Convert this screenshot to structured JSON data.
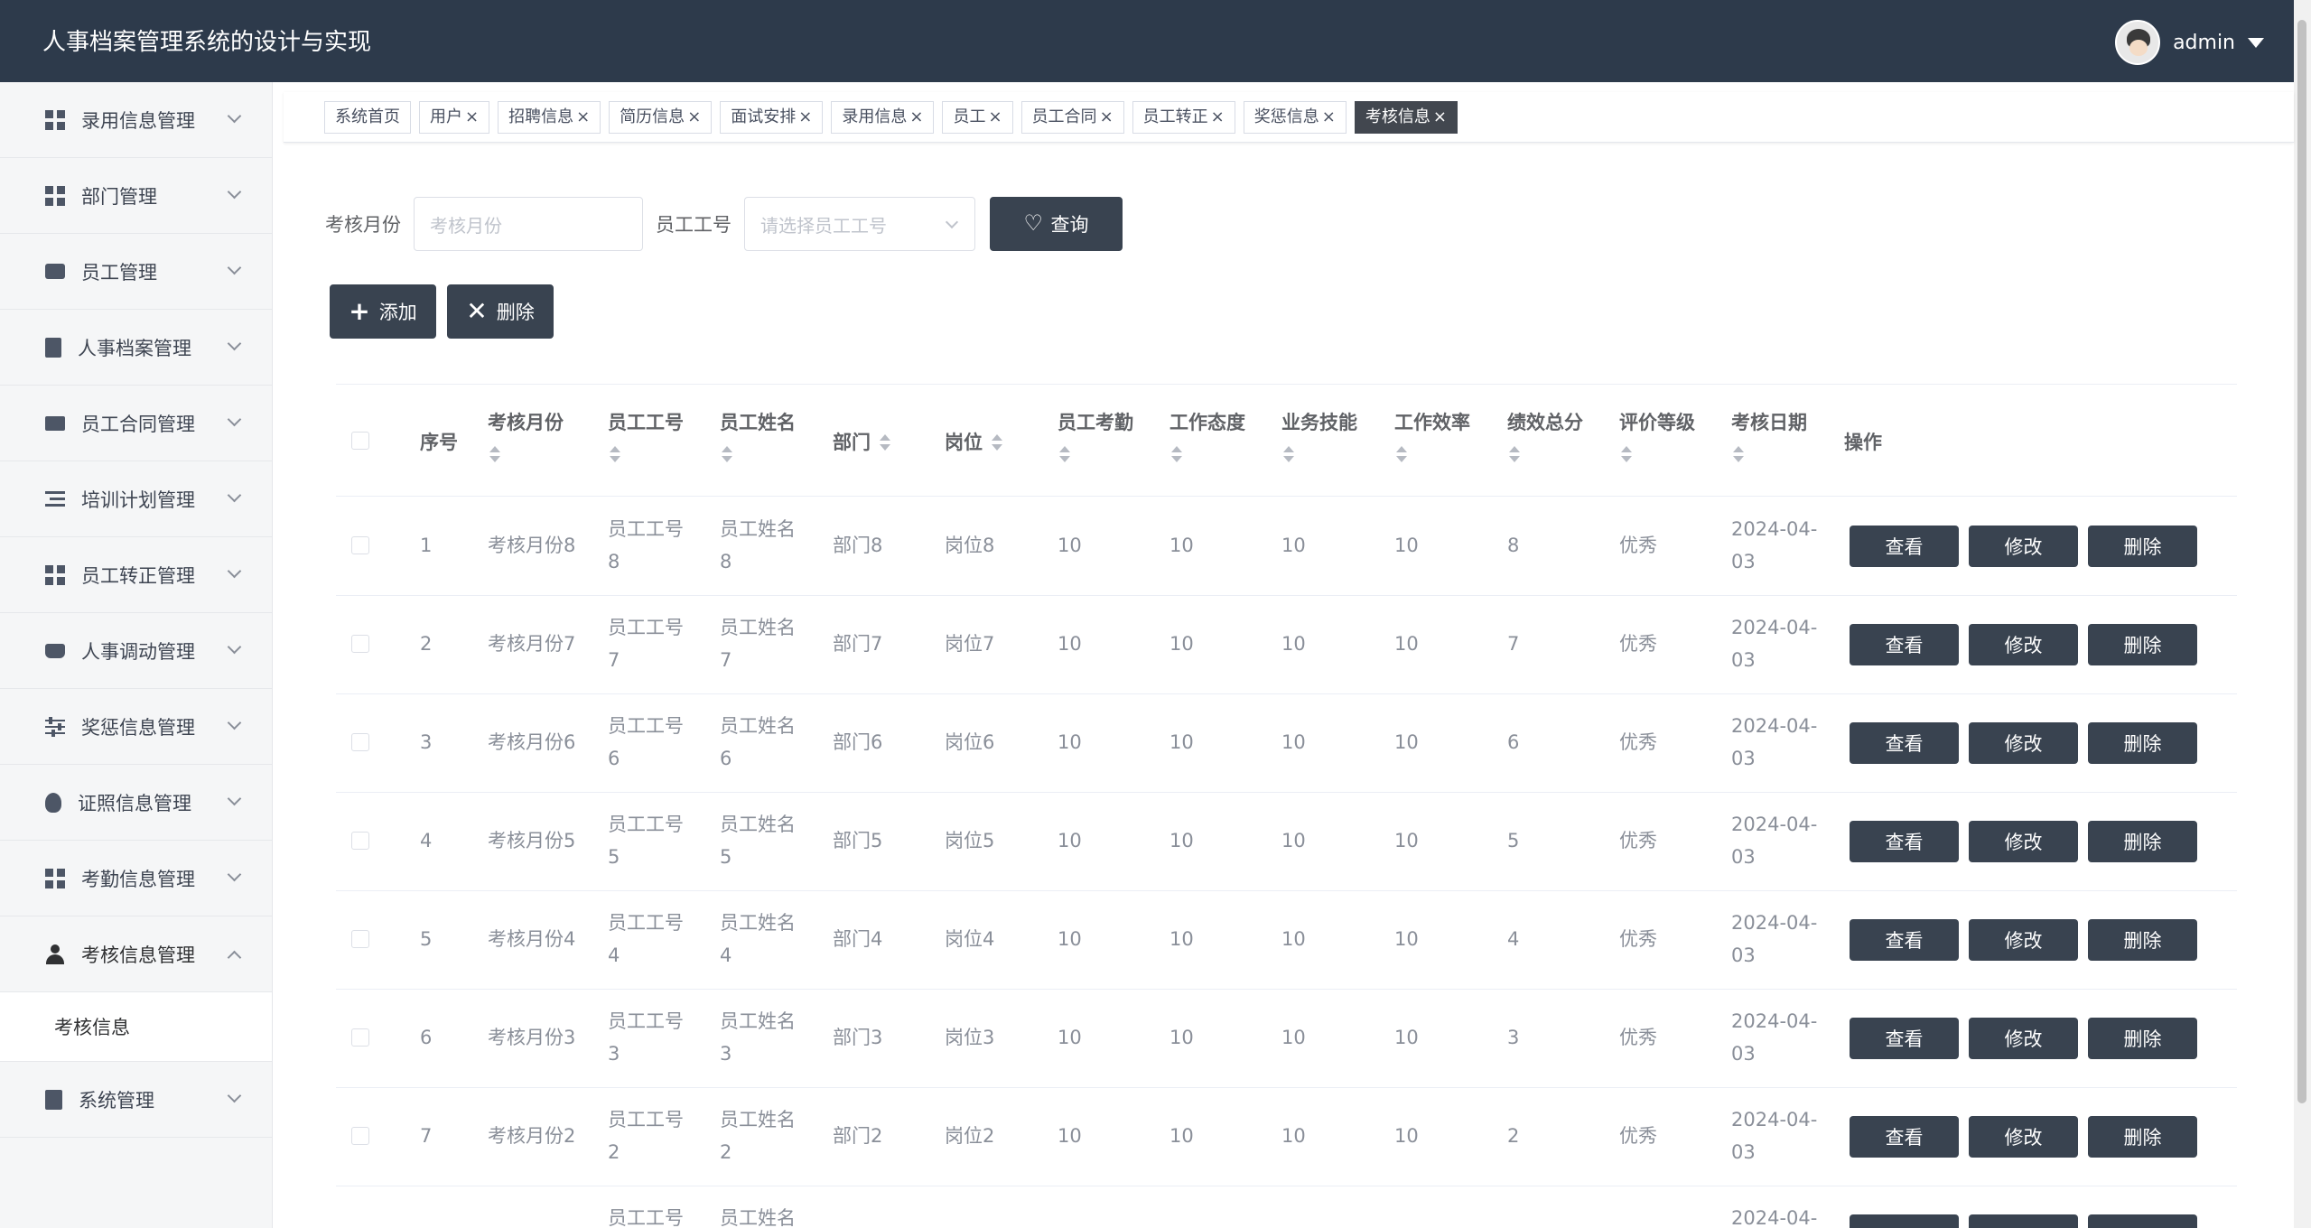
{
  "app": {
    "title": "人事档案管理系统的设计与实现",
    "user_name": "admin"
  },
  "sidebar": {
    "items": [
      {
        "label": "录用信息管理",
        "icon": "grid-icon"
      },
      {
        "label": "部门管理",
        "icon": "grid-icon"
      },
      {
        "label": "员工管理",
        "icon": "chat-icon"
      },
      {
        "label": "人事档案管理",
        "icon": "clipboard-icon"
      },
      {
        "label": "员工合同管理",
        "icon": "monitor-icon"
      },
      {
        "label": "培训计划管理",
        "icon": "list-icon"
      },
      {
        "label": "员工转正管理",
        "icon": "grid-icon"
      },
      {
        "label": "人事调动管理",
        "icon": "truck-icon"
      },
      {
        "label": "奖惩信息管理",
        "icon": "sliders-icon"
      },
      {
        "label": "证照信息管理",
        "icon": "bulb-icon"
      },
      {
        "label": "考勤信息管理",
        "icon": "grid-icon"
      },
      {
        "label": "考核信息管理",
        "icon": "user-icon",
        "open": true
      },
      {
        "label": "系统管理",
        "icon": "check-icon"
      }
    ],
    "open_sub_item": "考核信息"
  },
  "tabs": [
    {
      "label": "系统首页",
      "closable": false
    },
    {
      "label": "用户",
      "closable": true
    },
    {
      "label": "招聘信息",
      "closable": true
    },
    {
      "label": "简历信息",
      "closable": true
    },
    {
      "label": "面试安排",
      "closable": true
    },
    {
      "label": "录用信息",
      "closable": true
    },
    {
      "label": "员工",
      "closable": true
    },
    {
      "label": "员工合同",
      "closable": true
    },
    {
      "label": "员工转正",
      "closable": true
    },
    {
      "label": "奖惩信息",
      "closable": true
    },
    {
      "label": "考核信息",
      "closable": true,
      "active": true
    }
  ],
  "tab_close_glyph": "×",
  "search": {
    "month_label": "考核月份",
    "month_placeholder": "考核月份",
    "empno_label": "员工工号",
    "empno_placeholder": "请选择员工工号",
    "query_label": "查询"
  },
  "toolbar": {
    "add_label": "添加",
    "delete_label": "删除"
  },
  "table": {
    "headers": {
      "index": "序号",
      "month": "考核月份",
      "empno": "员工工号",
      "empname": "员工姓名",
      "dept": "部门",
      "post": "岗位",
      "attendance": "员工考勤",
      "attitude": "工作态度",
      "skill": "业务技能",
      "efficiency": "工作效率",
      "total": "绩效总分",
      "grade": "评价等级",
      "date": "考核日期",
      "ops": "操作"
    },
    "row_actions": {
      "view": "查看",
      "edit": "修改",
      "delete": "删除"
    },
    "rows": [
      {
        "index": "1",
        "month": "考核月份8",
        "empno_1": "员工工号",
        "empno_2": "8",
        "empname_1": "员工姓名",
        "empname_2": "8",
        "dept": "部门8",
        "post": "岗位8",
        "attendance": "10",
        "attitude": "10",
        "skill": "10",
        "efficiency": "10",
        "total": "8",
        "grade": "优秀",
        "date_1": "2024-04-",
        "date_2": "03"
      },
      {
        "index": "2",
        "month": "考核月份7",
        "empno_1": "员工工号",
        "empno_2": "7",
        "empname_1": "员工姓名",
        "empname_2": "7",
        "dept": "部门7",
        "post": "岗位7",
        "attendance": "10",
        "attitude": "10",
        "skill": "10",
        "efficiency": "10",
        "total": "7",
        "grade": "优秀",
        "date_1": "2024-04-",
        "date_2": "03"
      },
      {
        "index": "3",
        "month": "考核月份6",
        "empno_1": "员工工号",
        "empno_2": "6",
        "empname_1": "员工姓名",
        "empname_2": "6",
        "dept": "部门6",
        "post": "岗位6",
        "attendance": "10",
        "attitude": "10",
        "skill": "10",
        "efficiency": "10",
        "total": "6",
        "grade": "优秀",
        "date_1": "2024-04-",
        "date_2": "03"
      },
      {
        "index": "4",
        "month": "考核月份5",
        "empno_1": "员工工号",
        "empno_2": "5",
        "empname_1": "员工姓名",
        "empname_2": "5",
        "dept": "部门5",
        "post": "岗位5",
        "attendance": "10",
        "attitude": "10",
        "skill": "10",
        "efficiency": "10",
        "total": "5",
        "grade": "优秀",
        "date_1": "2024-04-",
        "date_2": "03"
      },
      {
        "index": "5",
        "month": "考核月份4",
        "empno_1": "员工工号",
        "empno_2": "4",
        "empname_1": "员工姓名",
        "empname_2": "4",
        "dept": "部门4",
        "post": "岗位4",
        "attendance": "10",
        "attitude": "10",
        "skill": "10",
        "efficiency": "10",
        "total": "4",
        "grade": "优秀",
        "date_1": "2024-04-",
        "date_2": "03"
      },
      {
        "index": "6",
        "month": "考核月份3",
        "empno_1": "员工工号",
        "empno_2": "3",
        "empname_1": "员工姓名",
        "empname_2": "3",
        "dept": "部门3",
        "post": "岗位3",
        "attendance": "10",
        "attitude": "10",
        "skill": "10",
        "efficiency": "10",
        "total": "3",
        "grade": "优秀",
        "date_1": "2024-04-",
        "date_2": "03"
      },
      {
        "index": "7",
        "month": "考核月份2",
        "empno_1": "员工工号",
        "empno_2": "2",
        "empname_1": "员工姓名",
        "empname_2": "2",
        "dept": "部门2",
        "post": "岗位2",
        "attendance": "10",
        "attitude": "10",
        "skill": "10",
        "efficiency": "10",
        "total": "2",
        "grade": "优秀",
        "date_1": "2024-04-",
        "date_2": "03"
      },
      {
        "empno_1": "员工工号",
        "empname_1": "员工姓名",
        "date_1": "2024-04-"
      }
    ]
  }
}
